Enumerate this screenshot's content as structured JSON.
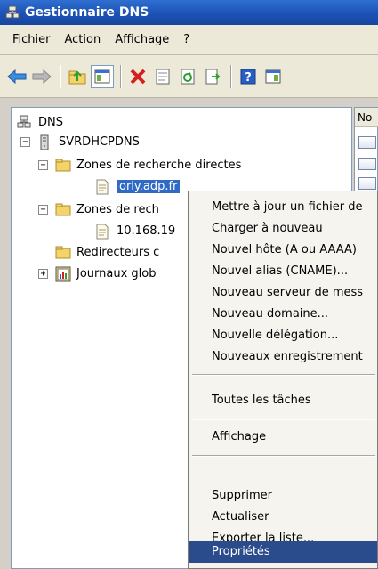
{
  "window": {
    "title": "Gestionnaire DNS"
  },
  "menubar": {
    "items": [
      "Fichier",
      "Action",
      "Affichage",
      "?"
    ]
  },
  "right_pane": {
    "column_header": "No"
  },
  "tree": {
    "root": "DNS",
    "server": "SVRDHCPDNS",
    "forward_zones": "Zones de recherche directes",
    "forward_zone_child": "orly.adp.fr",
    "reverse_zones": "Zones de rech",
    "reverse_zone_child": "10.168.19",
    "forwarders": "Redirecteurs c",
    "global_logs": "Journaux glob"
  },
  "context_menu": {
    "items": [
      "Mettre à jour un fichier de",
      "Charger à nouveau",
      "Nouvel hôte (A ou AAAA)",
      "Nouvel alias (CNAME)...",
      "Nouveau serveur de mess",
      "Nouveau domaine...",
      "Nouvelle délégation...",
      "Nouveaux enregistrement",
      "Toutes les tâches",
      "Affichage",
      "Supprimer",
      "Actualiser",
      "Exporter la liste...",
      "Propriétés"
    ],
    "highlighted": "Propriétés"
  },
  "colors": {
    "titlebar": "#1c52b5",
    "selection": "#316ac5",
    "menu_highlight": "#2b4c8c"
  }
}
